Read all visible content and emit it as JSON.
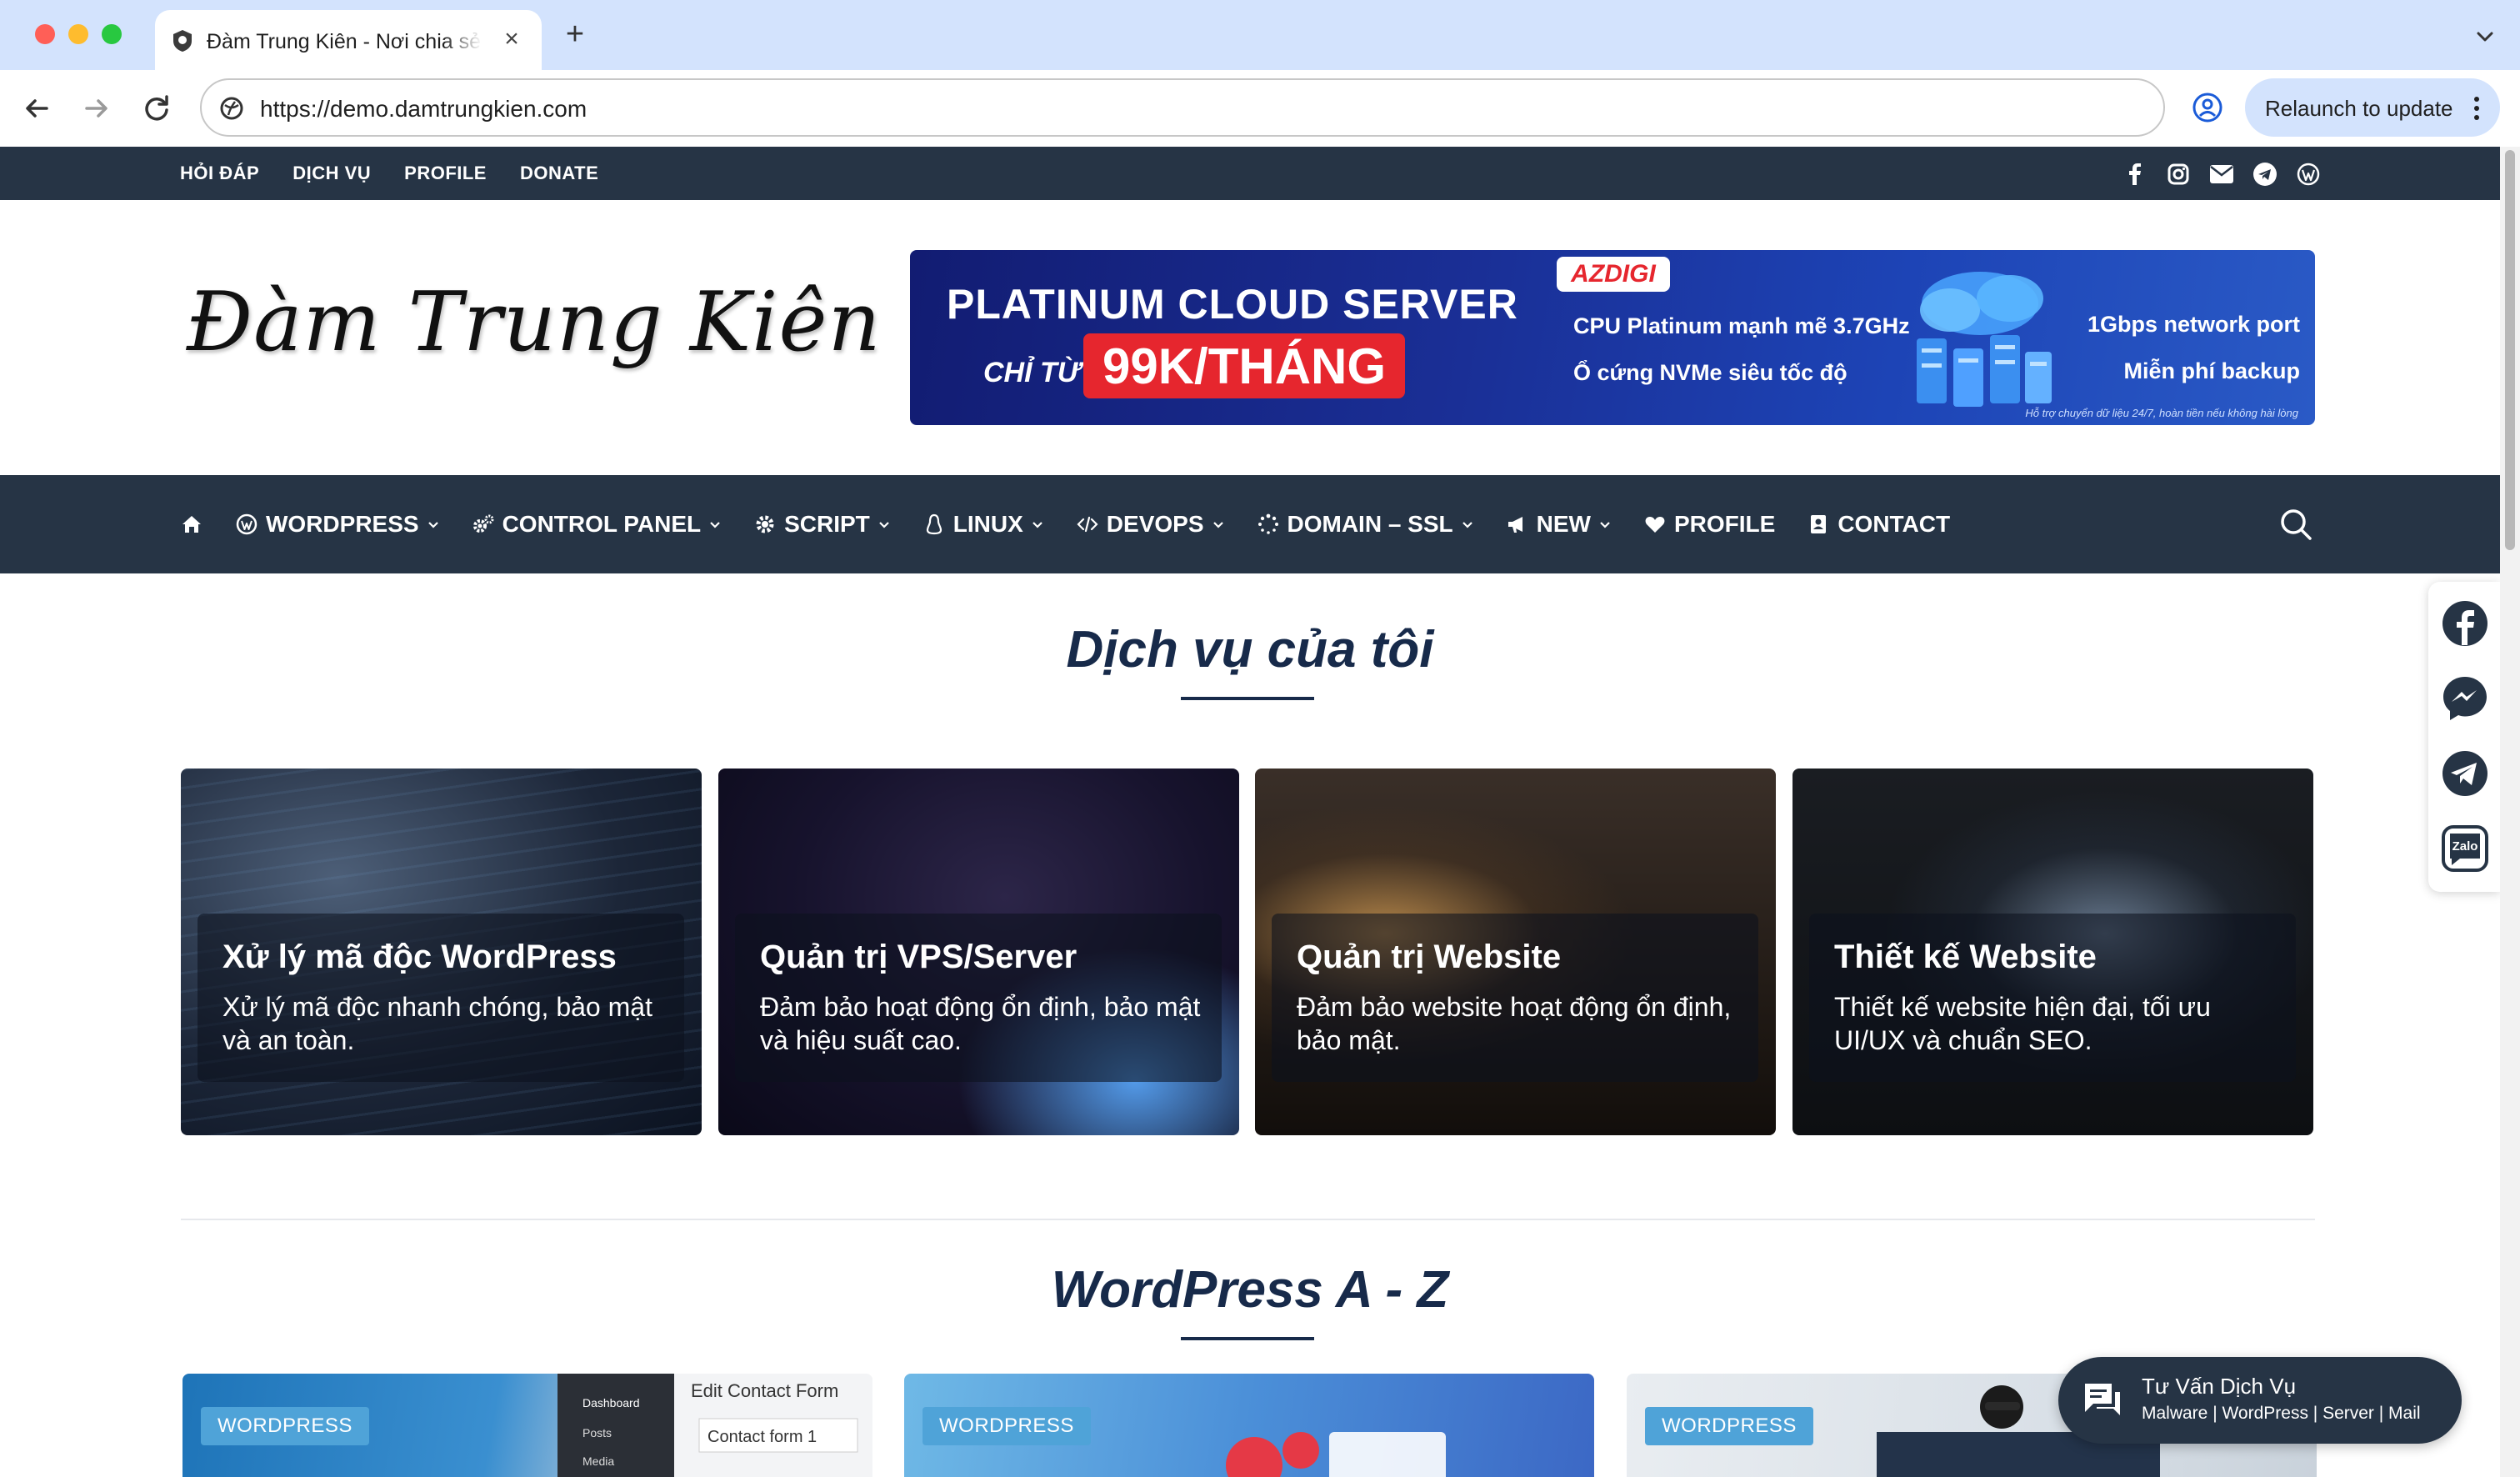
{
  "browser": {
    "tab_title": "Đàm Trung Kiên - Nơi chia sẻ kiến thức",
    "url": "https://demo.damtrungkien.com",
    "relaunch_label": "Relaunch to update"
  },
  "topbar": {
    "links": [
      "HỎI ĐÁP",
      "DỊCH VỤ",
      "PROFILE",
      "DONATE"
    ],
    "social_icons": [
      "facebook-icon",
      "instagram-icon",
      "mail-icon",
      "telegram-icon",
      "wordpress-icon"
    ]
  },
  "header": {
    "logo_text": "Đàm Trung Kiên"
  },
  "banner": {
    "title": "PLATINUM CLOUD SERVER",
    "from_label": "CHỈ TỪ",
    "price": "99K/THÁNG",
    "brand": "AZDIGI",
    "feature_1": "CPU Platinum mạnh mẽ 3.7GHz",
    "feature_2": "Ổ cứng NVMe siêu tốc độ",
    "feature_3": "1Gbps network port",
    "feature_4": "Miễn phí backup",
    "note": "Hỗ trợ chuyển dữ liệu 24/7, hoàn tiền nếu không hài lòng",
    "brand_color": "#e6262e"
  },
  "mainnav": {
    "items": [
      {
        "label": "WORDPRESS",
        "icon": "wordpress-icon"
      },
      {
        "label": "CONTROL PANEL",
        "icon": "cogs-icon"
      },
      {
        "label": "SCRIPT",
        "icon": "gear-icon"
      },
      {
        "label": "LINUX",
        "icon": "linux-icon"
      },
      {
        "label": "DEVOPS",
        "icon": "code-icon"
      },
      {
        "label": "DOMAIN – SSL",
        "icon": "spinner-icon"
      },
      {
        "label": "NEW",
        "icon": "megaphone-icon"
      },
      {
        "label": "PROFILE",
        "icon": "heart-icon"
      },
      {
        "label": "CONTACT",
        "icon": "contact-icon"
      }
    ]
  },
  "services": {
    "heading": "Dịch vụ của tôi",
    "cards": [
      {
        "title": "Xử lý mã độc WordPress",
        "desc": "Xử lý mã độc nhanh chóng, bảo mật và an toàn."
      },
      {
        "title": "Quản trị VPS/Server",
        "desc": "Đảm bảo hoạt động ổn định, bảo mật và hiệu suất cao."
      },
      {
        "title": "Quản trị Website",
        "desc": "Đảm bảo website hoạt động ổn định, bảo mật."
      },
      {
        "title": "Thiết kế Website",
        "desc": "Thiết kế website hiện đại, tối ưu UI/UX và chuẩn SEO."
      }
    ]
  },
  "wordpress_section": {
    "heading": "WordPress A - Z",
    "posts": [
      {
        "badge": "WORDPRESS",
        "thumb_text_1": "Edit Contact Form",
        "thumb_text_2": "Contact form 1",
        "thumb_menu_1": "Dashboard",
        "thumb_menu_2": "Posts",
        "thumb_menu_3": "Media"
      },
      {
        "badge": "WORDPRESS"
      },
      {
        "badge": "WORDPRESS"
      }
    ]
  },
  "chat_widget": {
    "title": "Tư Vấn Dịch Vụ",
    "subtitle": "Malware | WordPress | Server | Mail"
  },
  "float_social": {
    "zalo_label": "Zalo"
  },
  "colors": {
    "nav_bg": "#263445",
    "heading": "#172a4a",
    "badge": "#4fa3d8"
  }
}
